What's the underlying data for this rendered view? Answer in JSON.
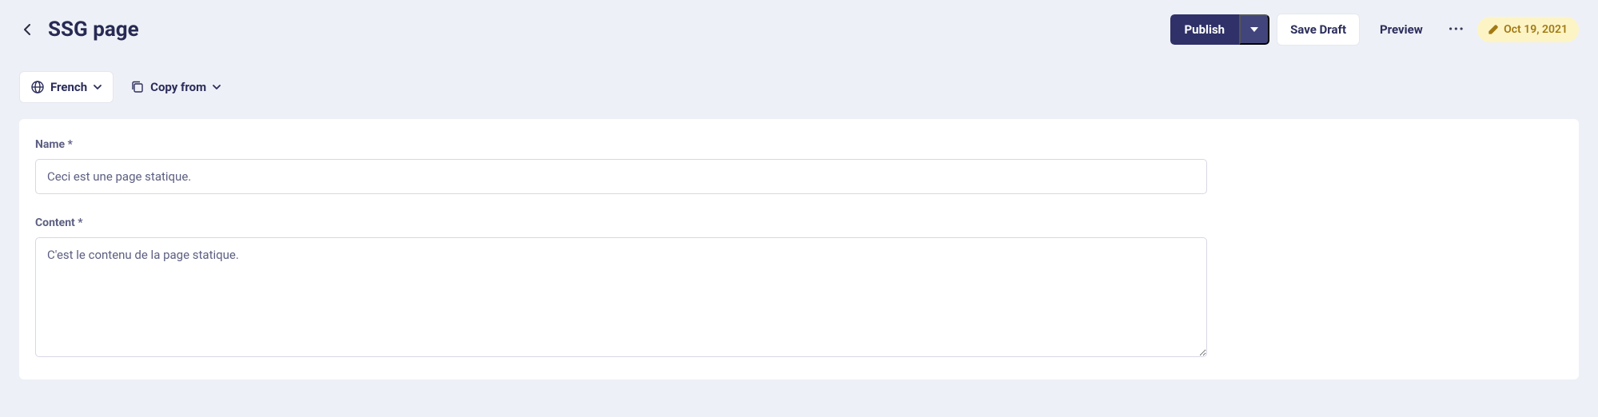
{
  "header": {
    "title": "SSG page",
    "publish_label": "Publish",
    "save_draft_label": "Save Draft",
    "preview_label": "Preview",
    "date_badge": "Oct 19, 2021"
  },
  "locale": {
    "selected": "French",
    "copy_from_label": "Copy from"
  },
  "form": {
    "name_label": "Name *",
    "name_value": "Ceci est une page statique.",
    "content_label": "Content *",
    "content_value": "C'est le contenu de la page statique."
  }
}
